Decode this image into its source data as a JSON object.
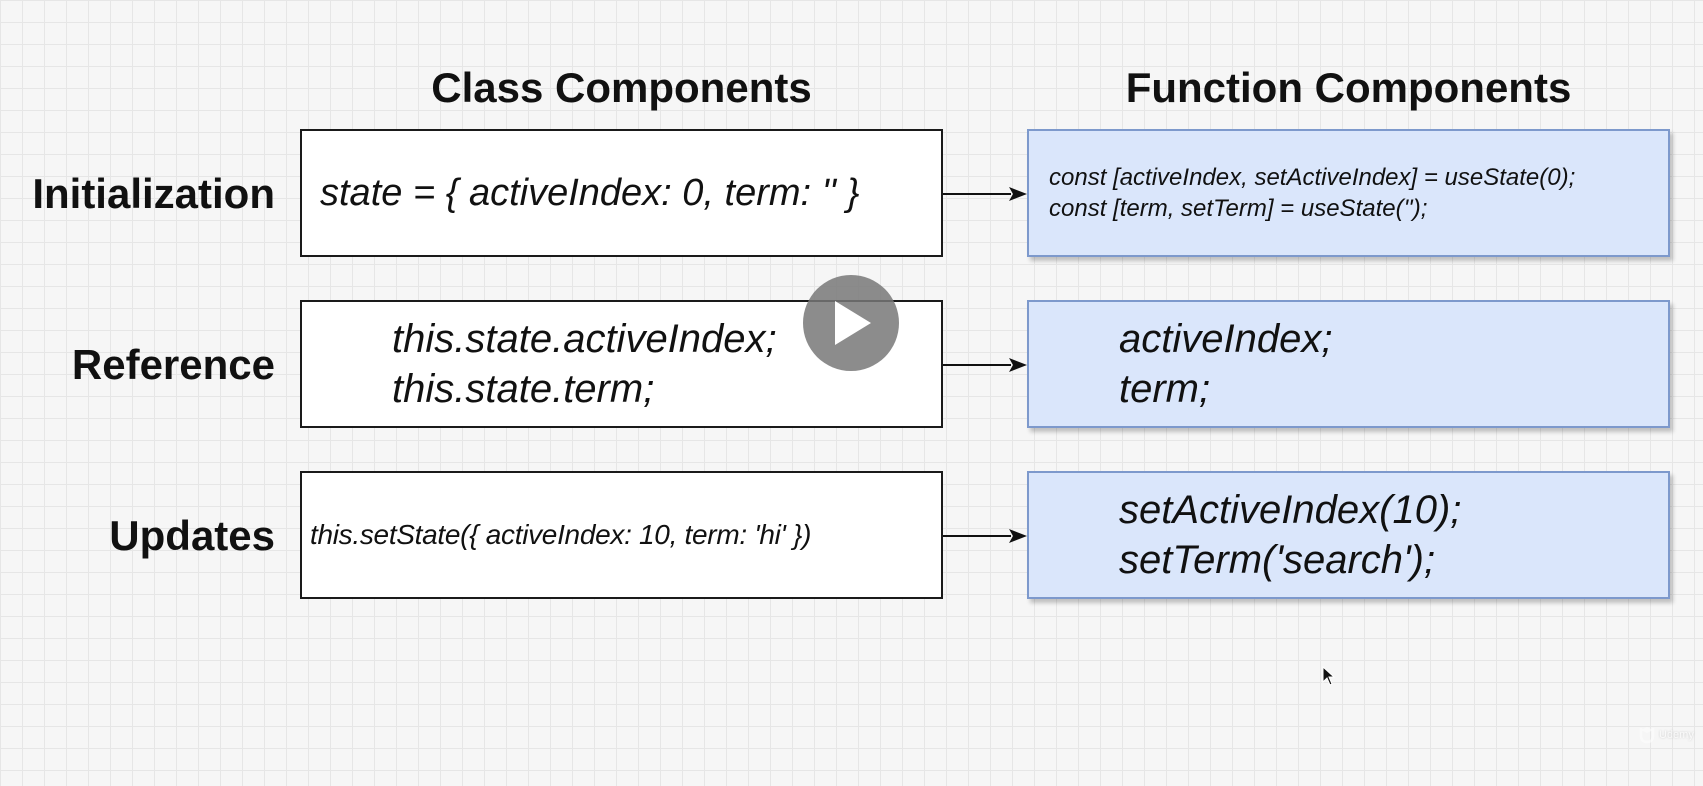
{
  "columns": {
    "class_header": "Class Components",
    "function_header": "Function Components"
  },
  "rows": [
    {
      "label": "Initialization",
      "class_code": [
        "state = { activeIndex: 0, term: '' }"
      ],
      "function_code": [
        "const [activeIndex, setActiveIndex] = useState(0);",
        "const [term, setTerm] = useState('');"
      ]
    },
    {
      "label": "Reference",
      "class_code": [
        "this.state.activeIndex;",
        "this.state.term;"
      ],
      "function_code": [
        "activeIndex;",
        "term;"
      ]
    },
    {
      "label": "Updates",
      "class_code": [
        "this.setState({ activeIndex: 10, term: 'hi' })"
      ],
      "function_code": [
        "setActiveIndex(10);",
        "setTerm('search');"
      ]
    }
  ],
  "watermark": {
    "logo": "udemy-logo",
    "text": "Udemy"
  },
  "icons": {
    "play": "play-icon",
    "cursor": "mouse-cursor-icon"
  },
  "colors": {
    "function_box_fill": "#dae6fb",
    "function_box_border": "#7d99cc",
    "class_box_fill": "#ffffff",
    "class_box_border": "#1a1a1a"
  }
}
